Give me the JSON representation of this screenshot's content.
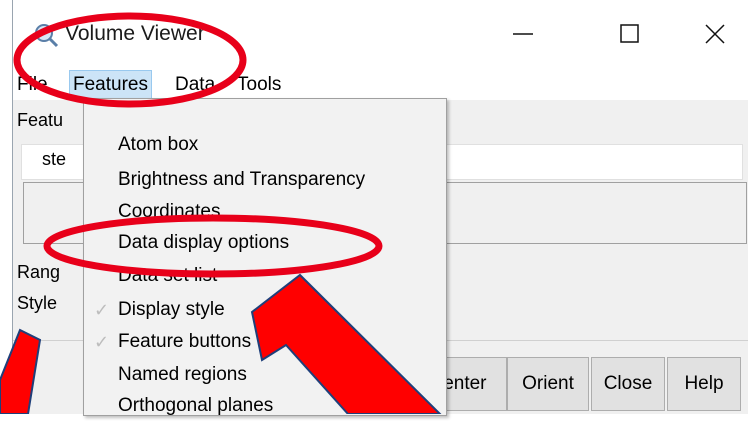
{
  "window": {
    "title": "Volume Viewer",
    "controls": {
      "minimize": "—",
      "maximize": "☐",
      "close": "✕"
    }
  },
  "menubar": {
    "items": [
      "File",
      "Features",
      "Data",
      "Tools"
    ]
  },
  "panel": {
    "features_label": "Featu",
    "step_label": "ste",
    "range_label": "Rang",
    "style_label": "Style"
  },
  "features_menu": {
    "items": [
      {
        "label": "Atom box",
        "checked": false
      },
      {
        "label": "Brightness and Transparency",
        "checked": false
      },
      {
        "label": "Coordinates",
        "checked": false
      },
      {
        "label": "Data display options",
        "checked": false
      },
      {
        "label": "Data set list",
        "checked": false
      },
      {
        "label": "Display style",
        "checked": true
      },
      {
        "label": "Feature buttons",
        "checked": true
      },
      {
        "label": "Named regions",
        "checked": false
      },
      {
        "label": "Orthogonal planes",
        "checked": false
      }
    ]
  },
  "bottom_buttons": {
    "center": "Center",
    "orient": "Orient",
    "close": "Close",
    "help": "Help"
  },
  "annotation_colors": {
    "circle": "#e8001a",
    "arrow_fill": "#ff0000",
    "arrow_outline": "#1f3f7a"
  }
}
